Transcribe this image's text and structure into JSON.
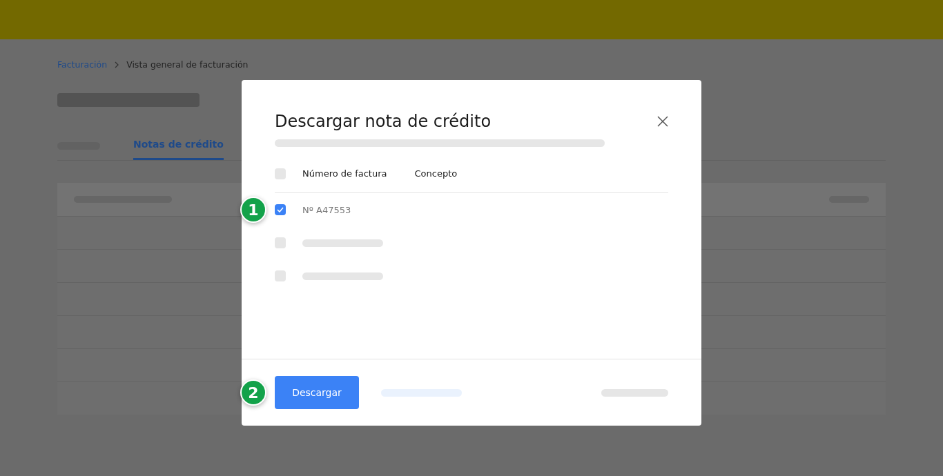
{
  "breadcrumb": [
    {
      "label": "Facturación",
      "kind": "link"
    },
    {
      "label": "Vista general de facturación",
      "kind": "current"
    }
  ],
  "tabs": [
    {
      "kind": "placeholder",
      "selected": false
    },
    {
      "kind": "text",
      "label": "Notas de crédito",
      "selected": true
    }
  ],
  "dialog": {
    "title": "Descargar nota de crédito",
    "columns": [
      "Número de factura",
      "Concepto"
    ],
    "select_all": {
      "checked": false
    },
    "rows": [
      {
        "kind": "text",
        "number": "Nº A47553",
        "checked": true,
        "step": "1"
      },
      {
        "kind": "placeholder",
        "checked": false
      },
      {
        "kind": "placeholder",
        "checked": false
      }
    ],
    "primary_button": {
      "label": "Descargar",
      "step": "2"
    }
  }
}
